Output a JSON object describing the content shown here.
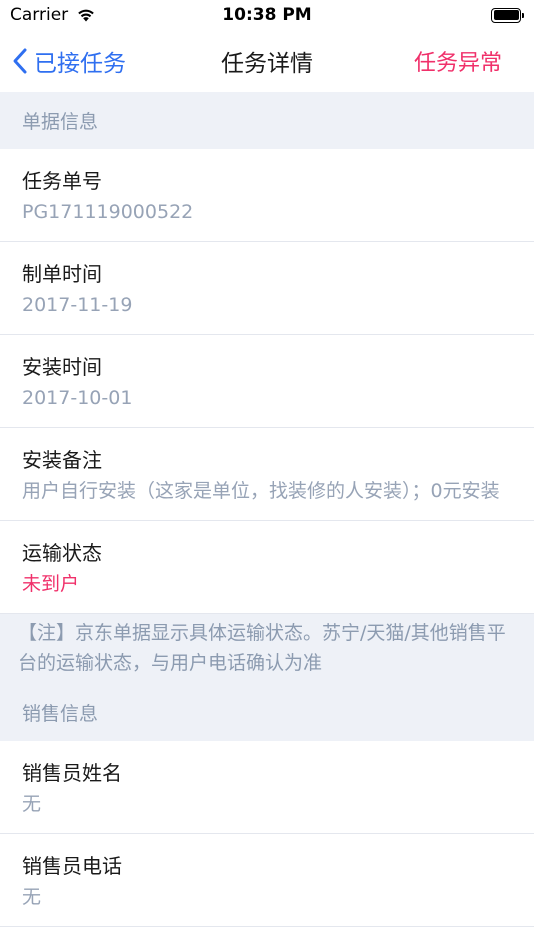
{
  "status_bar": {
    "carrier": "Carrier",
    "time": "10:38 PM"
  },
  "nav": {
    "back_label": "已接任务",
    "title": "任务详情",
    "right_label": "任务异常"
  },
  "sections": {
    "doc_info_header": "单据信息",
    "sales_info_header": "销售信息"
  },
  "rows": {
    "task_number": {
      "label": "任务单号",
      "value": "PG171119000522"
    },
    "create_time": {
      "label": "制单时间",
      "value": "2017-11-19"
    },
    "install_time": {
      "label": "安装时间",
      "value": "2017-10-01"
    },
    "install_note": {
      "label": "安装备注",
      "value": "用户自行安装（这家是单位，找装修的人安装）；0元安装"
    },
    "transport_status": {
      "label": "运输状态",
      "value": "未到户"
    },
    "salesperson_name": {
      "label": "销售员姓名",
      "value": "无"
    },
    "salesperson_phone": {
      "label": "销售员电话",
      "value": "无"
    }
  },
  "note_text": "【注】京东单据显示具体运输状态。苏宁/天猫/其他销售平台的运输状态，与用户电话确认为准",
  "colors": {
    "accent_blue": "#2f6ff0",
    "accent_red": "#f0306a",
    "section_bg": "#eef1f7"
  }
}
